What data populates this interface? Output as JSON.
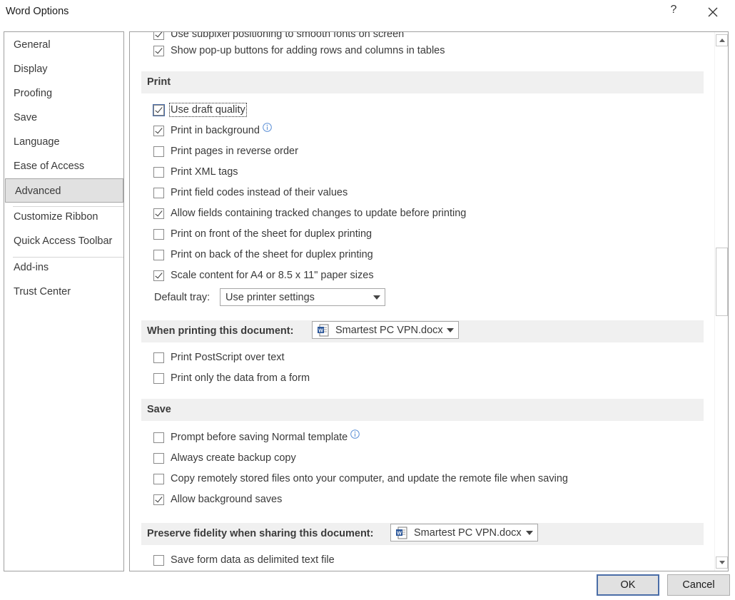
{
  "window": {
    "title": "Word Options",
    "help_label": "?"
  },
  "nav": {
    "items": [
      {
        "label": "General"
      },
      {
        "label": "Display"
      },
      {
        "label": "Proofing"
      },
      {
        "label": "Save"
      },
      {
        "label": "Language"
      },
      {
        "label": "Ease of Access"
      },
      {
        "label": "Advanced"
      },
      {
        "label": "Customize Ribbon"
      },
      {
        "label": "Quick Access Toolbar"
      },
      {
        "label": "Add-ins"
      },
      {
        "label": "Trust Center"
      }
    ],
    "selected": "Advanced"
  },
  "content": {
    "partial_top_row": "Use subpixel positioning to smooth fonts on screen",
    "table_row": {
      "label": "Show pop-up buttons for adding rows and columns in tables",
      "checked": true
    },
    "print": {
      "header": "Print",
      "options": [
        {
          "label": "Use draft quality",
          "checked": true
        },
        {
          "label": "Print in background",
          "checked": true
        },
        {
          "label": "Print pages in reverse order",
          "checked": false
        },
        {
          "label": "Print XML tags",
          "checked": false
        },
        {
          "label": "Print field codes instead of their values",
          "checked": false
        },
        {
          "label": "Allow fields containing tracked changes to update before printing",
          "checked": true
        },
        {
          "label": "Print on front of the sheet for duplex printing",
          "checked": false
        },
        {
          "label": "Print on back of the sheet for duplex printing",
          "checked": false
        },
        {
          "label": "Scale content for A4 or 8.5 x 11\" paper sizes",
          "checked": true
        }
      ],
      "default_tray_label": "Default tray:",
      "default_tray_value": "Use printer settings"
    },
    "when_printing": {
      "header": "When printing this document:",
      "document": "Smartest PC VPN.docx",
      "options": [
        {
          "label": "Print PostScript over text",
          "checked": false
        },
        {
          "label": "Print only the data from a form",
          "checked": false
        }
      ]
    },
    "save": {
      "header": "Save",
      "options": [
        {
          "label": "Prompt before saving Normal template",
          "checked": false
        },
        {
          "label": "Always create backup copy",
          "checked": false
        },
        {
          "label": "Copy remotely stored files onto your computer, and update the remote file when saving",
          "checked": false
        },
        {
          "label": "Allow background saves",
          "checked": true
        }
      ]
    },
    "fidelity": {
      "header": "Preserve fidelity when sharing this document:",
      "document": "Smartest PC VPN.docx",
      "options": [
        {
          "label": "Save form data as delimited text file",
          "checked": false
        }
      ]
    }
  },
  "buttons": {
    "ok": "OK",
    "cancel": "Cancel"
  },
  "colors": {
    "accent": "#4a6da7",
    "section_bg": "#f0f0f0",
    "selected_nav_bg": "#e1e1e1"
  }
}
